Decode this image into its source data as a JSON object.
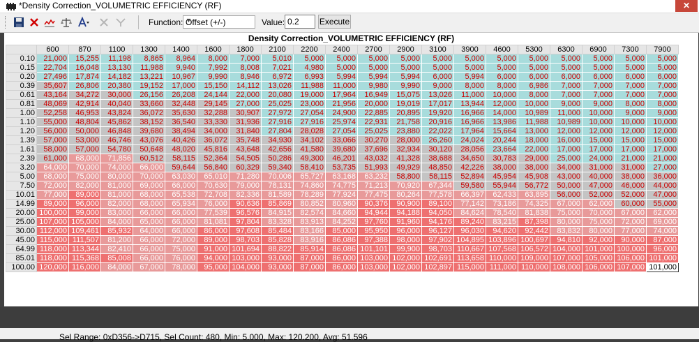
{
  "window": {
    "title": "*Density Correction_VOLUMETRIC EFFICIENCY (RF)"
  },
  "toolbar": {
    "icons": [
      "save-icon",
      "delete-icon",
      "graph-icon",
      "balance-icon",
      "text-format-icon",
      "tool-disabled-icon",
      "filter-disabled-icon"
    ],
    "function_label": "Function:",
    "function_value": "Offset (+/-)",
    "value_label": "Value:",
    "value": "0.2",
    "execute_label": "Execute"
  },
  "table": {
    "title": "Density Correction_VOLUMETRIC EFFICIENCY (RF)",
    "columns": [
      "600",
      "870",
      "1100",
      "1300",
      "1400",
      "1600",
      "1800",
      "2100",
      "2200",
      "2400",
      "2700",
      "2900",
      "3100",
      "3900",
      "4600",
      "5300",
      "6300",
      "6900",
      "7300",
      "7900"
    ],
    "rows": [
      {
        "label": "0.10",
        "values": [
          "21,000",
          "15,255",
          "11,198",
          "8,865",
          "8,964",
          "8,000",
          "7,000",
          "5,010",
          "5,000",
          "5,000",
          "5,000",
          "5,000",
          "5,000",
          "5,000",
          "5,000",
          "5,000",
          "5,000",
          "5,000",
          "5,000",
          "5,000"
        ]
      },
      {
        "label": "0.15",
        "values": [
          "22,704",
          "16,048",
          "13,130",
          "11,988",
          "9,940",
          "7,992",
          "8,008",
          "7,021",
          "4,980",
          "5,000",
          "5,000",
          "5,000",
          "5,000",
          "5,000",
          "5,000",
          "5,000",
          "5,000",
          "5,000",
          "5,000",
          "5,000"
        ]
      },
      {
        "label": "0.20",
        "values": [
          "27,496",
          "17,874",
          "14,182",
          "13,221",
          "10,967",
          "9,990",
          "8,946",
          "6,972",
          "6,993",
          "5,994",
          "5,994",
          "5,994",
          "6,000",
          "5,994",
          "6,000",
          "6,000",
          "6,000",
          "6,000",
          "6,000",
          "6,000"
        ]
      },
      {
        "label": "0.39",
        "values": [
          "35,607",
          "26,806",
          "20,380",
          "19,152",
          "17,000",
          "15,150",
          "14,112",
          "13,026",
          "11,988",
          "11,000",
          "9,980",
          "9,990",
          "9,000",
          "8,000",
          "8,000",
          "6,986",
          "7,000",
          "7,000",
          "7,000",
          "7,000"
        ]
      },
      {
        "label": "0.61",
        "values": [
          "43,164",
          "34,272",
          "30,000",
          "26,156",
          "26,208",
          "24,144",
          "22,000",
          "20,080",
          "19,000",
          "17,964",
          "16,949",
          "15,075",
          "13,026",
          "11,000",
          "10,000",
          "8,000",
          "7,000",
          "7,000",
          "7,000",
          "7,000"
        ]
      },
      {
        "label": "0.81",
        "values": [
          "48,069",
          "42,914",
          "40,040",
          "33,660",
          "32,448",
          "29,145",
          "27,000",
          "25,025",
          "23,000",
          "21,956",
          "20,000",
          "19,019",
          "17,017",
          "13,944",
          "12,000",
          "10,000",
          "9,000",
          "9,000",
          "8,000",
          "8,000"
        ]
      },
      {
        "label": "1.00",
        "values": [
          "52,258",
          "46,953",
          "43,824",
          "36,072",
          "35,630",
          "32,288",
          "30,907",
          "27,972",
          "27,054",
          "24,900",
          "22,885",
          "20,895",
          "19,920",
          "16,966",
          "14,000",
          "10,989",
          "11,000",
          "10,000",
          "9,000",
          "9,000"
        ]
      },
      {
        "label": "1.10",
        "values": [
          "55,000",
          "48,804",
          "45,862",
          "38,152",
          "36,540",
          "33,330",
          "31,936",
          "27,916",
          "27,916",
          "25,974",
          "22,931",
          "21,758",
          "20,916",
          "16,966",
          "13,986",
          "11,988",
          "10,989",
          "10,000",
          "10,000",
          "10,000"
        ]
      },
      {
        "label": "1.20",
        "values": [
          "56,000",
          "50,000",
          "46,848",
          "39,680",
          "38,494",
          "34,000",
          "31,840",
          "27,804",
          "28,028",
          "27,054",
          "25,025",
          "23,880",
          "22,022",
          "17,964",
          "15,664",
          "13,000",
          "12,000",
          "12,000",
          "12,000",
          "12,000"
        ]
      },
      {
        "label": "1.39",
        "values": [
          "57,000",
          "53,000",
          "46,746",
          "43,076",
          "40,426",
          "36,072",
          "35,748",
          "34,930",
          "34,102",
          "33,066",
          "30,270",
          "28,000",
          "26,260",
          "24,024",
          "20,244",
          "18,000",
          "16,000",
          "15,000",
          "15,000",
          "15,000"
        ]
      },
      {
        "label": "1.61",
        "values": [
          "58,000",
          "57,000",
          "54,780",
          "50,648",
          "48,020",
          "45,816",
          "43,648",
          "42,656",
          "41,580",
          "39,680",
          "37,696",
          "32,934",
          "30,120",
          "28,056",
          "23,664",
          "22,000",
          "17,000",
          "17,000",
          "17,000",
          "17,000"
        ]
      },
      {
        "label": "2.39",
        "values": [
          "61,000",
          "68,000",
          "71,856",
          "60,512",
          "58,115",
          "52,364",
          "54,505",
          "50,286",
          "49,300",
          "46,201",
          "43,032",
          "41,328",
          "38,688",
          "34,650",
          "30,783",
          "29,000",
          "25,000",
          "24,000",
          "21,000",
          "21,000"
        ]
      },
      {
        "label": "3.20",
        "values": [
          "64,000",
          "70,000",
          "74,000",
          "66,000",
          "59,644",
          "56,840",
          "60,329",
          "59,340",
          "58,410",
          "53,735",
          "51,993",
          "49,929",
          "48,850",
          "42,226",
          "38,000",
          "38,000",
          "34,000",
          "31,000",
          "31,000",
          "27,000"
        ]
      },
      {
        "label": "5.00",
        "values": [
          "68,000",
          "75,000",
          "80,000",
          "70,000",
          "63,030",
          "65,010",
          "71,280",
          "70,006",
          "65,727",
          "63,168",
          "63,232",
          "58,800",
          "58,115",
          "52,894",
          "45,954",
          "45,908",
          "43,000",
          "40,000",
          "38,000",
          "36,000"
        ]
      },
      {
        "label": "7.50",
        "values": [
          "72,000",
          "82,000",
          "81,000",
          "69,000",
          "66,000",
          "70,630",
          "79,000",
          "78,131",
          "74,860",
          "74,775",
          "71,213",
          "70,920",
          "67,344",
          "59,580",
          "55,944",
          "56,772",
          "50,000",
          "47,000",
          "46,000",
          "44,000"
        ]
      },
      {
        "label": "10.01",
        "values": [
          "77,000",
          "89,000",
          "81,000",
          "68,000",
          "65,538",
          "72,708",
          "82,336",
          "81,589",
          "78,289",
          "77,924",
          "77,475",
          "80,264",
          "77,578",
          "66,397",
          "62,433",
          "63,895",
          "56,000",
          "52,000",
          "52,000",
          "47,000"
        ]
      },
      {
        "label": "14.99",
        "values": [
          "89,000",
          "96,000",
          "82,000",
          "68,000",
          "65,934",
          "76,000",
          "90,636",
          "85,869",
          "80,852",
          "80,960",
          "90,376",
          "90,900",
          "89,100",
          "77,142",
          "73,186",
          "74,325",
          "67,000",
          "62,000",
          "60,000",
          "55,000"
        ]
      },
      {
        "label": "20.00",
        "values": [
          "100,000",
          "99,000",
          "83,000",
          "66,000",
          "66,000",
          "77,539",
          "96,576",
          "84,915",
          "82,574",
          "84,660",
          "94,944",
          "94,188",
          "94,050",
          "84,624",
          "78,540",
          "81,838",
          "75,000",
          "70,000",
          "67,000",
          "62,000"
        ]
      },
      {
        "label": "25.00",
        "values": [
          "107,000",
          "105,000",
          "84,000",
          "65,000",
          "66,000",
          "81,081",
          "97,804",
          "83,328",
          "83,913",
          "84,252",
          "97,760",
          "91,960",
          "94,176",
          "89,240",
          "83,215",
          "87,398",
          "80,000",
          "75,000",
          "72,000",
          "69,000"
        ]
      },
      {
        "label": "30.00",
        "values": [
          "112,000",
          "109,461",
          "85,932",
          "64,000",
          "66,000",
          "86,000",
          "97,608",
          "85,484",
          "83,166",
          "85,000",
          "95,950",
          "96,000",
          "96,127",
          "96,030",
          "94,620",
          "92,442",
          "83,832",
          "80,000",
          "77,000",
          "74,000"
        ]
      },
      {
        "label": "45.00",
        "values": [
          "115,000",
          "111,507",
          "81,200",
          "66,000",
          "72,000",
          "89,000",
          "98,703",
          "85,828",
          "83,916",
          "86,086",
          "97,388",
          "98,000",
          "97,902",
          "104,895",
          "103,896",
          "100,697",
          "94,810",
          "92,000",
          "90,000",
          "87,000"
        ]
      },
      {
        "label": "64.99",
        "values": [
          "118,000",
          "113,344",
          "82,410",
          "66,000",
          "75,000",
          "91,000",
          "101,694",
          "88,822",
          "85,914",
          "86,086",
          "101,101",
          "99,900",
          "98,703",
          "110,667",
          "107,568",
          "106,572",
          "104,000",
          "101,000",
          "100,000",
          "96,000"
        ]
      },
      {
        "label": "85.01",
        "values": [
          "118,000",
          "115,368",
          "85,008",
          "66,000",
          "76,000",
          "94,000",
          "103,000",
          "93,000",
          "87,000",
          "86,000",
          "103,000",
          "102,000",
          "102,691",
          "113,658",
          "110,000",
          "109,000",
          "107,000",
          "105,000",
          "106,000",
          "101,000"
        ]
      },
      {
        "label": "100.00",
        "values": [
          "120,000",
          "116,000",
          "84,000",
          "67,000",
          "78,000",
          "95,000",
          "104,000",
          "93,000",
          "87,000",
          "86,000",
          "103,000",
          "102,000",
          "102,897",
          "115,000",
          "111,000",
          "110,000",
          "108,000",
          "106,000",
          "107,000",
          "101,000"
        ]
      }
    ]
  },
  "status": {
    "text": "Sel Range: 0xD356->D715, Sel Count: 480, Min: 5.000, Max: 120.200, Avg: 51.596"
  },
  "colors": {
    "low": "#a8dcdc",
    "mid": "#c8c8c8",
    "high": "#f08080",
    "low_text": "#cc0000",
    "high_text": "#ffffff"
  }
}
